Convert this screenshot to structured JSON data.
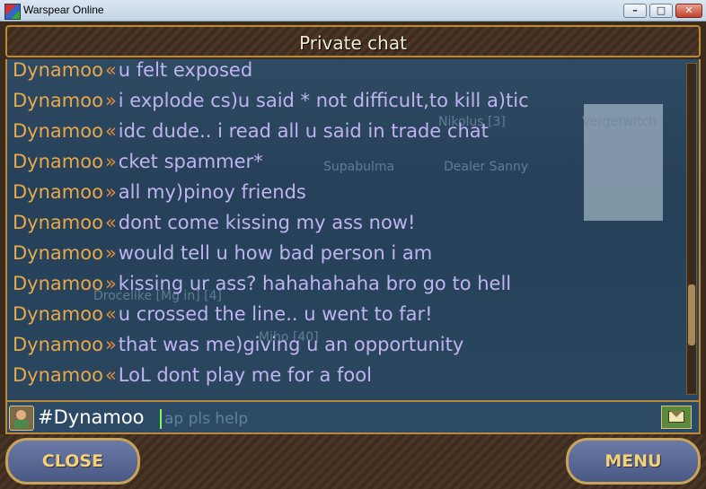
{
  "window": {
    "title": "Warspear Online",
    "minimize": "–",
    "maximize": "□",
    "close": "✕"
  },
  "header": {
    "title": "Private chat"
  },
  "background_names": [
    "Nikolus [3]",
    "Vergetwitch",
    "Supabulma",
    "Dealer Sanny",
    "Drocellke [Mg in] [4]",
    "Miho [40]"
  ],
  "messages": [
    {
      "nick": "Dynamoo",
      "dir": "«",
      "text": "u felt exposed"
    },
    {
      "nick": "Dynamoo",
      "dir": "»",
      "text": "i explode cs)u said * not difficult,to kill a)tic"
    },
    {
      "nick": "Dynamoo",
      "dir": "«",
      "text": "idc dude.. i read all u said in trade chat"
    },
    {
      "nick": "Dynamoo",
      "dir": "»",
      "text": "cket spammer*"
    },
    {
      "nick": "Dynamoo",
      "dir": "»",
      "text": "all my)pinoy friends"
    },
    {
      "nick": "Dynamoo",
      "dir": "«",
      "text": "dont come kissing my ass now!"
    },
    {
      "nick": "Dynamoo",
      "dir": "»",
      "text": "would tell u how bad person i am"
    },
    {
      "nick": "Dynamoo",
      "dir": "»",
      "text": "kissing ur ass? hahahahaha bro go to hell"
    },
    {
      "nick": "Dynamoo",
      "dir": "«",
      "text": "u crossed the line.. u went to far!"
    },
    {
      "nick": "Dynamoo",
      "dir": "»",
      "text": "that was me)giving u an opportunity"
    },
    {
      "nick": "Dynamoo",
      "dir": "«",
      "text": "LoL dont play me for a fool"
    }
  ],
  "input": {
    "value": "#Dynamoo",
    "ghost": "ap pls help"
  },
  "buttons": {
    "close": "CLOSE",
    "menu": "MENU"
  },
  "icons": {
    "send": "envelope-icon",
    "avatar": "player-avatar-icon"
  },
  "colors": {
    "nick": "#e8a94a",
    "message": "#bfb4f0",
    "frame": "#b98a3a"
  }
}
